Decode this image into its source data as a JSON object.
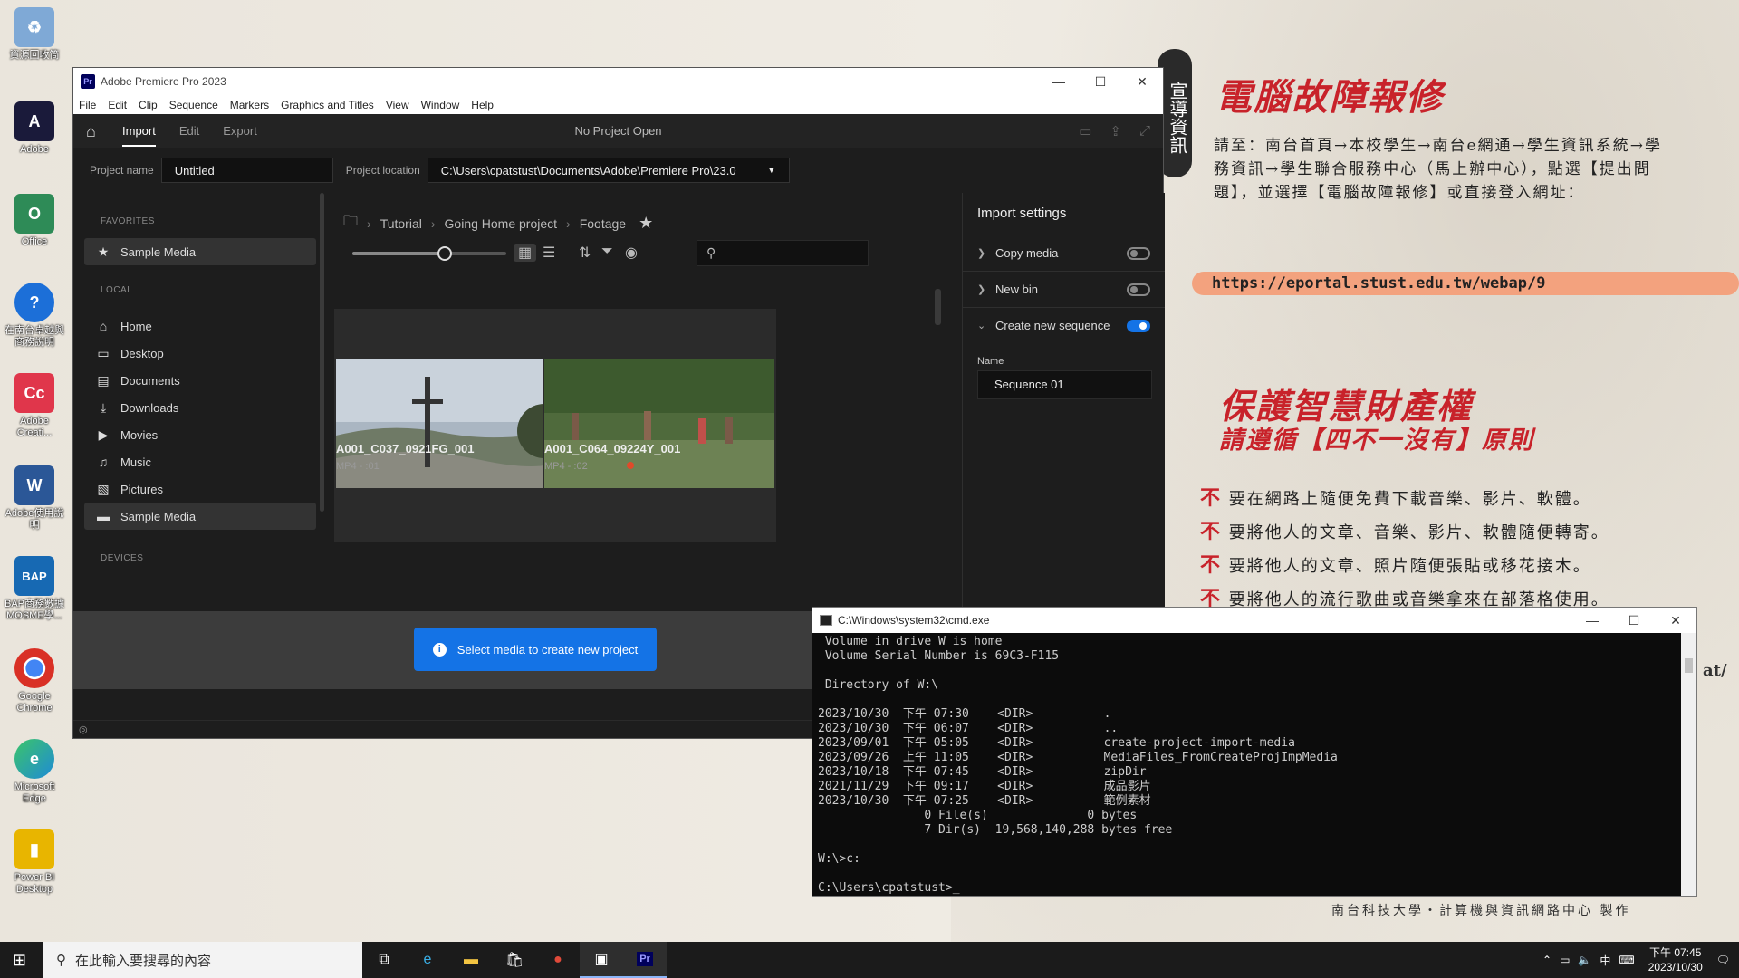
{
  "desktop": {
    "icons": [
      {
        "label": "資源回收筒",
        "name": "recycle-bin",
        "color": "#7fa9d6",
        "glyph": "♻"
      },
      {
        "label": "Adobe",
        "name": "adobe",
        "color": "#1a1a3a",
        "glyph": "A"
      },
      {
        "label": "Office",
        "name": "office",
        "color": "#2e8b57",
        "glyph": "O"
      },
      {
        "label": "在南台卓越與商務說明",
        "name": "help",
        "color": "#1c6fd8",
        "glyph": "?"
      },
      {
        "label": "Adobe Creati...",
        "name": "adobe-creative-cloud",
        "color": "#e0364b",
        "glyph": "Cc"
      },
      {
        "label": "Adobe使用說明",
        "name": "word-doc",
        "color": "#2b5797",
        "glyph": "W"
      },
      {
        "label": "BAP商務數據MOSME學...",
        "name": "bap",
        "color": "#1769b3",
        "glyph": "BAP"
      },
      {
        "label": "Google Chrome",
        "name": "google-chrome",
        "color": "#d93025",
        "glyph": "●"
      },
      {
        "label": "Microsoft Edge",
        "name": "microsoft-edge",
        "color": "#1f8bd6",
        "glyph": "e"
      },
      {
        "label": "Power BI Desktop",
        "name": "power-bi",
        "color": "#e8b500",
        "glyph": "▮"
      }
    ]
  },
  "poster": {
    "tab": "宣導資訊",
    "title": "電腦故障報修",
    "text": "請至：南台首頁→本校學生→南台e網通→學生資訊系統→學務資訊→學生聯合服務中心（馬上辦中心），點選【提出問題】，並選擇【電腦故障報修】或直接登入網址：",
    "url": "https://eportal.stust.edu.tw/webap/9",
    "title2": "保護智慧財產權",
    "subtitle2": "請遵循【四不一沒有】原則",
    "rules": [
      "要在網路上隨便免費下載音樂、影片、軟體。",
      "要將他人的文章、音樂、影片、軟體隨便轉寄。",
      "要將他人的文章、照片隨便張貼或移花接木。",
      "要將他人的流行歌曲或音樂拿來在部落格使用。"
    ],
    "rule_prefix": "不",
    "side": "at/",
    "footer": "南台科技大學・計算機與資訊網路中心 製作"
  },
  "premiere": {
    "title": "Adobe Premiere Pro 2023",
    "menu": [
      "File",
      "Edit",
      "Clip",
      "Sequence",
      "Markers",
      "Graphics and Titles",
      "View",
      "Window",
      "Help"
    ],
    "tabs": {
      "import": "Import",
      "edit": "Edit",
      "export": "Export"
    },
    "header_center": "No Project Open",
    "project_name_label": "Project name",
    "project_name_value": "Untitled",
    "project_location_label": "Project location",
    "project_location_value": "C:\\Users\\cpatstust\\Documents\\Adobe\\Premiere Pro\\23.0",
    "sidebar": {
      "favorites_label": "FAVORITES",
      "favorites": [
        {
          "label": "Sample Media",
          "icon": "star-icon"
        }
      ],
      "local_label": "LOCAL",
      "local": [
        {
          "label": "Home",
          "icon": "home-icon"
        },
        {
          "label": "Desktop",
          "icon": "desktop-icon"
        },
        {
          "label": "Documents",
          "icon": "document-icon"
        },
        {
          "label": "Downloads",
          "icon": "download-icon"
        },
        {
          "label": "Movies",
          "icon": "movie-icon"
        },
        {
          "label": "Music",
          "icon": "music-icon"
        },
        {
          "label": "Pictures",
          "icon": "picture-icon"
        },
        {
          "label": "Sample Media",
          "icon": "folder-icon"
        }
      ],
      "devices_label": "DEVICES"
    },
    "breadcrumb": [
      "Tutorial",
      "Going Home project",
      "Footage"
    ],
    "zoom_level": 0.6,
    "search_placeholder": "",
    "media": [
      {
        "name": "A001_C037_0921FG_001",
        "meta": "MP4 - :01"
      },
      {
        "name": "A001_C064_09224Y_001",
        "meta": "MP4 - :02"
      }
    ],
    "toast": "Select media to create new project",
    "import_settings": {
      "title": "Import settings",
      "copy_media": "Copy media",
      "new_bin": "New bin",
      "create_sequence": "Create new sequence",
      "copy_media_on": false,
      "new_bin_on": false,
      "create_sequence_on": true,
      "name_label": "Name",
      "sequence_name": "Sequence 01"
    }
  },
  "cmd": {
    "title": "C:\\Windows\\system32\\cmd.exe",
    "lines": [
      " Volume in drive W is home",
      " Volume Serial Number is 69C3-F115",
      "",
      " Directory of W:\\",
      "",
      "2023/10/30  下午 07:30    <DIR>          .",
      "2023/10/30  下午 06:07    <DIR>          ..",
      "2023/09/01  下午 05:05    <DIR>          create-project-import-media",
      "2023/09/26  上午 11:05    <DIR>          MediaFiles_FromCreateProjImpMedia",
      "2023/10/18  下午 07:45    <DIR>          zipDir",
      "2021/11/29  下午 09:17    <DIR>          成品影片",
      "2023/10/30  下午 07:25    <DIR>          範例素材",
      "               0 File(s)              0 bytes",
      "               7 Dir(s)  19,568,140,288 bytes free",
      "",
      "W:\\>c:",
      "",
      "C:\\Users\\cpatstust>_"
    ]
  },
  "taskbar": {
    "search_placeholder": "在此輸入要搜尋的內容",
    "ime": "中",
    "time": "下午 07:45",
    "date": "2023/10/30"
  },
  "colors": {
    "accent": "#1473e6",
    "poster_red": "#c8222a"
  }
}
